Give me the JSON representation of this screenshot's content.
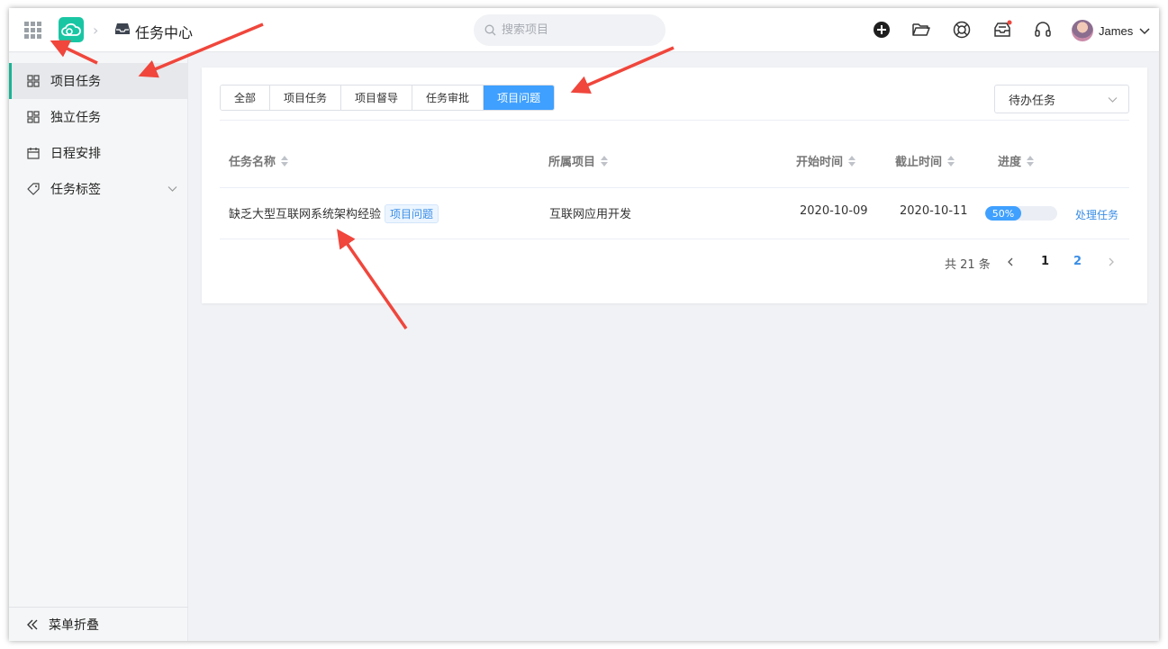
{
  "header": {
    "breadcrumb_title": "任务中心",
    "search_placeholder": "搜索项目",
    "user_name": "James"
  },
  "sidebar": {
    "items": [
      {
        "label": "项目任务",
        "active": true
      },
      {
        "label": "独立任务",
        "active": false
      },
      {
        "label": "日程安排",
        "active": false
      },
      {
        "label": "任务标签",
        "active": false
      }
    ],
    "collapse_label": "菜单折叠"
  },
  "tabs": [
    {
      "label": "全部",
      "active": false
    },
    {
      "label": "项目任务",
      "active": false
    },
    {
      "label": "项目督导",
      "active": false
    },
    {
      "label": "任务审批",
      "active": false
    },
    {
      "label": "项目问题",
      "active": true
    }
  ],
  "filter": {
    "selected": "待办任务"
  },
  "table": {
    "columns": [
      "任务名称",
      "所属项目",
      "开始时间",
      "截止时间",
      "进度"
    ],
    "rows": [
      {
        "name": "缺乏大型互联网系统架构经验",
        "tag": "项目问题",
        "project": "互联网应用开发",
        "start": "2020-10-09",
        "end": "2020-10-11",
        "progress": 50,
        "progress_label": "50%",
        "action": "处理任务"
      }
    ]
  },
  "pagination": {
    "total_label": "共 21 条",
    "pages": [
      "1",
      "2"
    ],
    "current": "1"
  },
  "colors": {
    "accent": "#3fa0ff",
    "brand": "#19c6a4",
    "annotation": "#f0463c"
  }
}
